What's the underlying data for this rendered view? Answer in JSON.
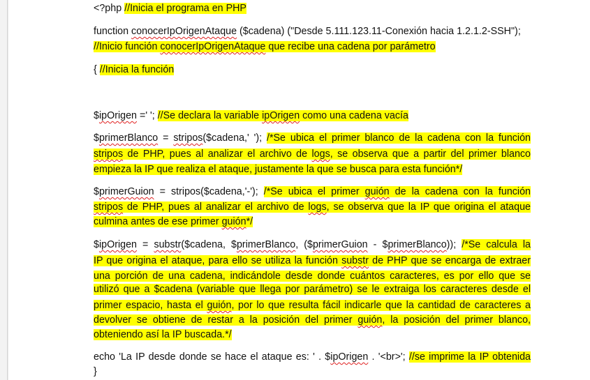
{
  "lines": {
    "l1_code": "<?php ",
    "l1_comment": "//Inicia el programa en PHP",
    "l2_a": "function ",
    "l2_fn": "conocerIpOrigenAtaque",
    "l2_b": " ($cadena) (\"Desde 5.111.123.11-Conexión hacia 1.2.1.2-SSH\");",
    "l3_a": "//Inicio función ",
    "l3_fn": "conocerIpOrigenAtaque",
    "l3_b": " que recibe una cadena por parámetro",
    "l4_code": "{ ",
    "l4_comment": "//Inicia la función",
    "l5_a": "$",
    "l5_var": "ipOrigen",
    "l5_b": " =' ';  ",
    "l5_c1": "//Se declara la variable ",
    "l5_c_var": "ipOrigen",
    "l5_c2": " como una cadena vacía",
    "b1_l1_a": "$",
    "b1_l1_var": "primerBlanco",
    "b1_l1_b": " = ",
    "b1_l1_fn": "stripos",
    "b1_l1_c": "($cadena,' ');  ",
    "b1_l1_comment": "/*Se ubica el primer blanco de la cadena con la función",
    "b1_l2_fn": "stripos",
    "b1_l2_a": " de PHP, pues al analizar el archivo de ",
    "b1_l2_logs": "logs",
    "b1_l2_b": ", se observa que a partir del primer blanco",
    "b1_l3": "empieza la IP que realiza el ataque, justamente la que se busca para esta función*/",
    "b2_l1_a": " $",
    "b2_l1_var": "primerGuion",
    "b2_l1_b": " =   ",
    "b2_l1_fn": "stripos",
    "b2_l1_c": "($cadena,'-');  ",
    "b2_l1_comment1": "/*Se ubica el primer ",
    "b2_l1_guion": "guión",
    "b2_l1_comment2": " de la cadena con la función",
    "b2_l2_fn": "stripos",
    "b2_l2_a": " de PHP, pues al analizar el archivo de ",
    "b2_l2_logs": "logs",
    "b2_l2_b": ", se observa que la IP que origina el ataque",
    "b2_l3_a": "culmina antes de ese primer ",
    "b2_l3_guion": "guión",
    "b2_l3_b": "*/",
    "b3_l1_a": " $",
    "b3_l1_var": "ipOrigen",
    "b3_l1_b": " = ",
    "b3_l1_fn": "substr",
    "b3_l1_c": "($cadena, $",
    "b3_l1_var2": "primerBlanco",
    "b3_l1_d": ", ($",
    "b3_l1_var3": "primerGuion",
    "b3_l1_e": " - $",
    "b3_l1_var4": "primerBlanco",
    "b3_l1_f": "));   ",
    "b3_l1_comment": "/*Se  calcula la",
    "b3_l2_a": "IP que origina el ataque, para ello se utiliza la función ",
    "b3_l2_fn": "substr",
    "b3_l2_b": " de PHP que se encarga de extraer",
    "b3_l3": "una porción de una cadena, indicándole desde donde cuántos caracteres, es por ello que se",
    "b3_l4": "utilizó que a $cadena (variable que llega por parámetro) se le extraiga los caracteres desde el",
    "b3_l5_a": "primer espacio, hasta el ",
    "b3_l5_guion": "guión",
    "b3_l5_b": ", por lo que resulta fácil indicarle que la cantidad de caracteres a",
    "b3_l6_a": "devolver se obtiene de restar a la posición del primer ",
    "b3_l6_guion": "guión",
    "b3_l6_b": ", la posición del primer blanco,",
    "b3_l7": "obteniendo así la IP buscada.*/",
    "l_echo_a": "echo 'La IP desde donde se hace el ataque es: ' . $",
    "l_echo_var": "ipOrigen",
    "l_echo_b": " . '<br>';  ",
    "l_echo_comment": "//se imprime la IP obtenida",
    "l_close": "}"
  },
  "colors": {
    "highlight": "#ffff00",
    "squiggle": "#e02020",
    "text": "#111111"
  }
}
